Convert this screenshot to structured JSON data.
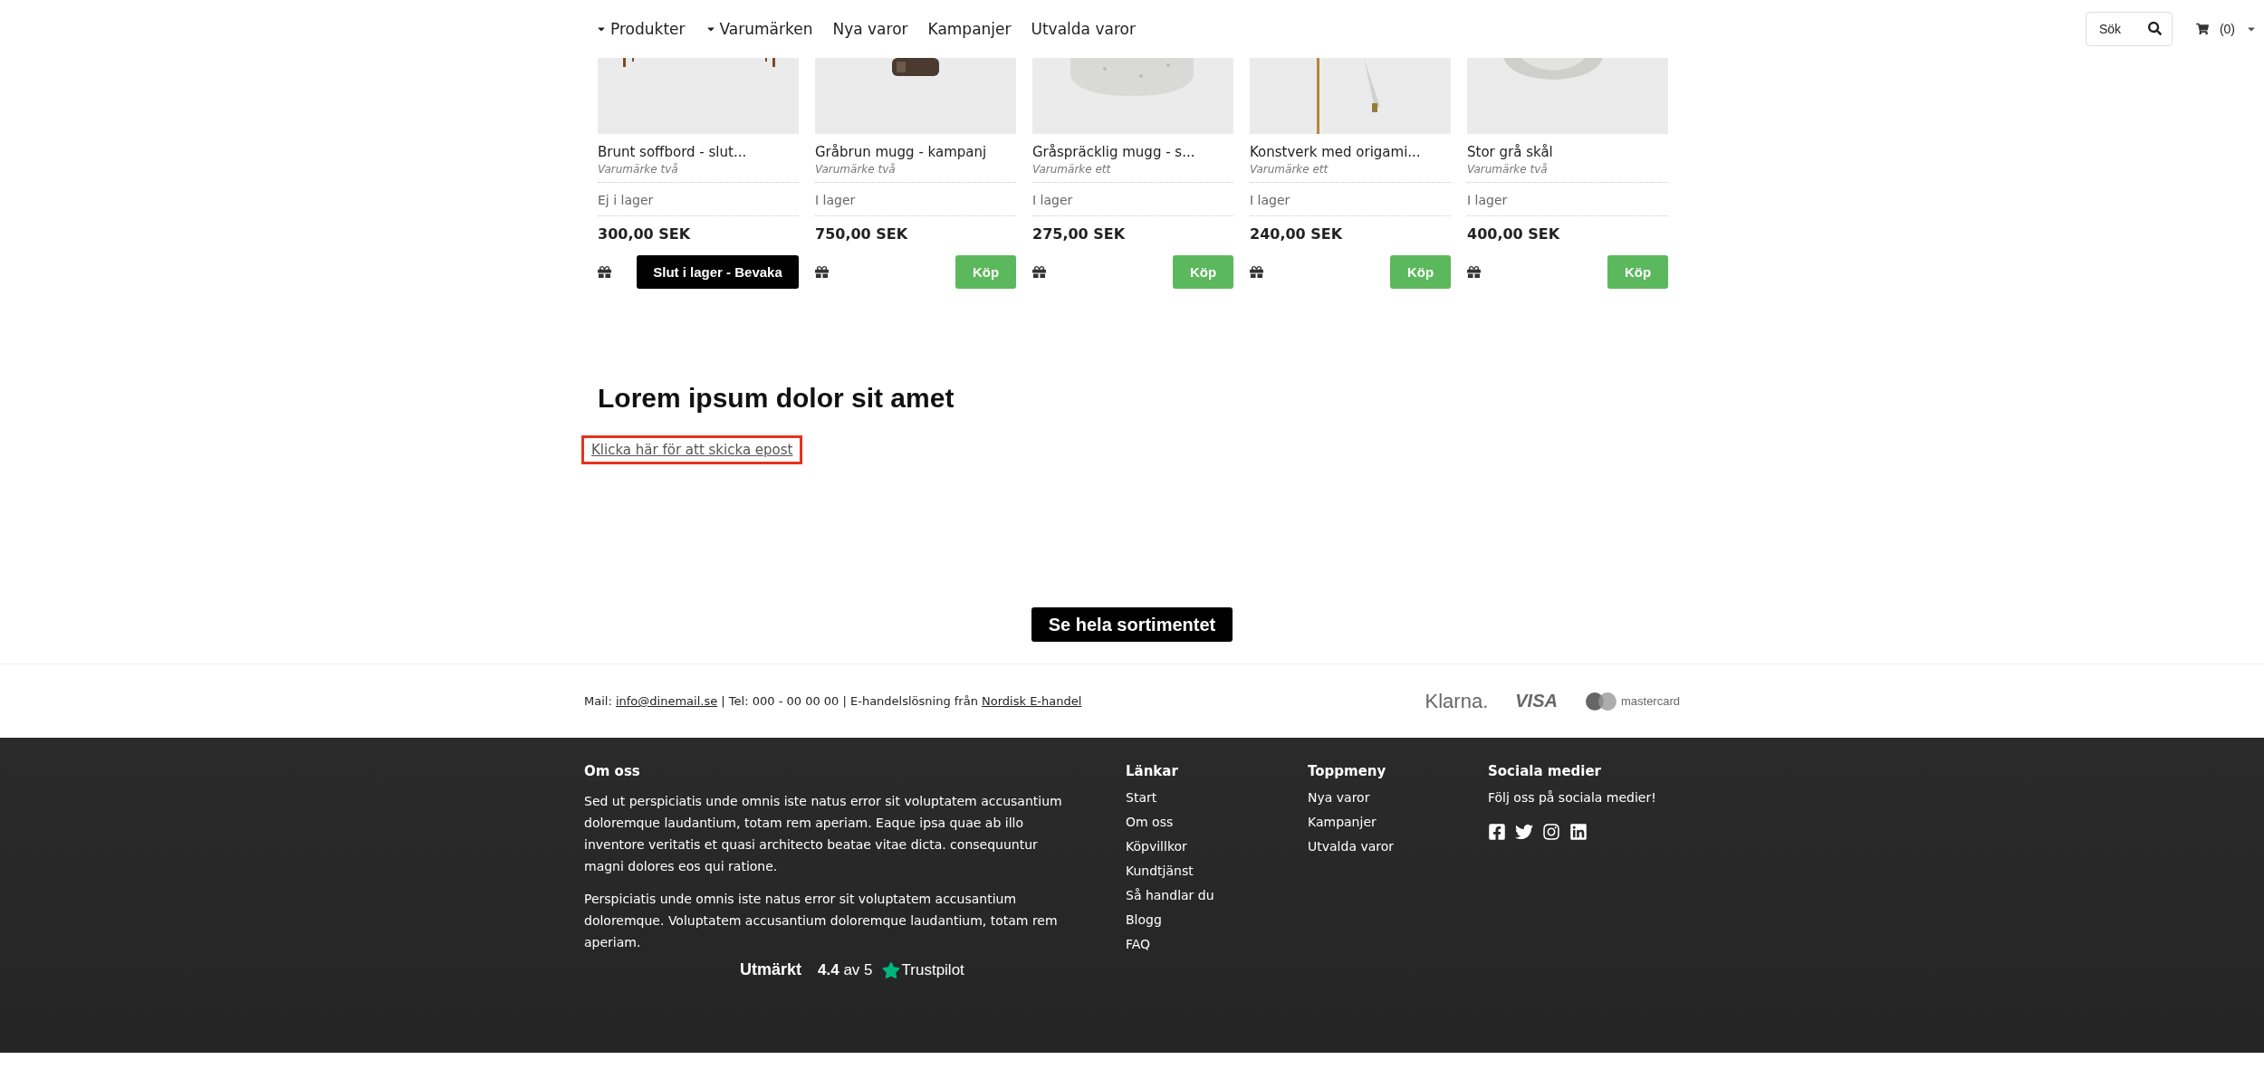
{
  "nav": {
    "items": [
      {
        "label": "Produkter",
        "dropdown": true
      },
      {
        "label": "Varumärken",
        "dropdown": true
      },
      {
        "label": "Nya varor",
        "dropdown": false
      },
      {
        "label": "Kampanjer",
        "dropdown": false
      },
      {
        "label": "Utvalda varor",
        "dropdown": false
      }
    ],
    "search": {
      "placeholder": "Sök"
    },
    "cart": {
      "count": "(0)"
    }
  },
  "products": [
    {
      "title": "Brunt soffbord - slut...",
      "brand": "Varumärke två",
      "stock": "Ej i lager",
      "in_stock": false,
      "price": "300,00 SEK",
      "action": "Slut i lager - Bevaka"
    },
    {
      "title": "Gråbrun mugg - kampanj",
      "brand": "Varumärke två",
      "stock": "I lager",
      "in_stock": true,
      "price": "750,00 SEK",
      "action": "Köp"
    },
    {
      "title": "Gråspräcklig mugg - s...",
      "brand": "Varumärke ett",
      "stock": "I lager",
      "in_stock": true,
      "price": "275,00 SEK",
      "action": "Köp"
    },
    {
      "title": "Konstverk med origami...",
      "brand": "Varumärke ett",
      "stock": "I lager",
      "in_stock": true,
      "price": "240,00 SEK",
      "action": "Köp"
    },
    {
      "title": "Stor grå skål",
      "brand": "Varumärke två",
      "stock": "I lager",
      "in_stock": true,
      "price": "400,00 SEK",
      "action": "Köp"
    }
  ],
  "section": {
    "heading": "Lorem ipsum dolor sit amet",
    "link": {
      "label": "Klicka här för att skicka epost",
      "highlighted": true
    }
  },
  "cta": "Se hela sortimentet",
  "contact": {
    "mail_label": "Mail:",
    "email": "info@dinemail.se",
    "middle": " | Tel: 000 - 00 00 00 | E-handelslösning från ",
    "vendor": "Nordisk E-handel"
  },
  "payment_logos": [
    "Klarna.",
    "VISA",
    "mastercard"
  ],
  "footer": {
    "about": {
      "heading": "Om oss",
      "paragraphs": [
        "Sed ut perspiciatis unde omnis iste natus error sit voluptatem accusantium doloremque laudantium, totam rem aperiam. Eaque ipsa quae ab illo inventore veritatis et quasi architecto beatae vitae dicta. consequuntur magni dolores eos qui ratione.",
        "Perspiciatis unde omnis iste natus error sit voluptatem accusantium doloremque. Voluptatem accusantium doloremque laudantium, totam rem aperiam."
      ]
    },
    "links": {
      "heading": "Länkar",
      "items": [
        "Start",
        "Om oss",
        "Köpvillkor",
        "Kundtjänst",
        "Så handlar du",
        "Blogg",
        "FAQ"
      ]
    },
    "top_menu": {
      "heading": "Toppmeny",
      "items": [
        "Nya varor",
        "Kampanjer",
        "Utvalda varor"
      ]
    },
    "social": {
      "heading": "Sociala medier",
      "text": "Följ oss på sociala medier!"
    },
    "trustpilot": {
      "rating": "Utmärkt",
      "score": "4.4",
      "scale": "av 5",
      "brand": "Trustpilot"
    }
  }
}
